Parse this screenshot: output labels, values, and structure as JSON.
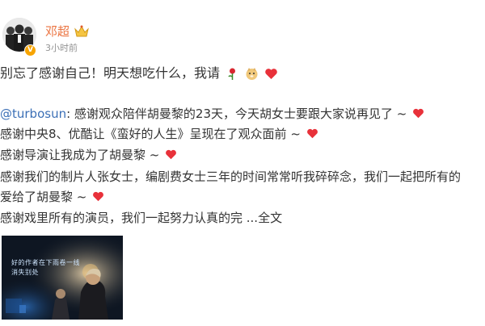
{
  "post": {
    "author": {
      "name": "邓超",
      "time": "3小时前",
      "avatar_icon": "avatar-group-photo",
      "verified_icon": "verified-badge-icon",
      "crown_badge_icon": "fan-crown-badge-icon"
    },
    "headline": "别忘了感谢自己！明天想吃什么，我请",
    "headline_emojis": [
      "rose-icon",
      "doge-icon",
      "heart-icon"
    ],
    "lines": [
      {
        "mention": "@turbosun",
        "text": ": 感谢观众陪伴胡曼黎的23天，今天胡女士要跟大家说再见了 ~",
        "emoji": "heart-icon"
      },
      {
        "text": "感谢中央8、优酷让《蛮好的人生》呈现在了观众面前 ~",
        "emoji": "heart-icon"
      },
      {
        "text": "感谢导演让我成为了胡曼黎 ~",
        "emoji": "heart-icon"
      },
      {
        "text": "感谢我们的制片人张女士，编剧费女士三年的时间常常听我碎碎念，我们一起把所有的"
      },
      {
        "text": "爱给了胡曼黎 ~",
        "emoji": "heart-icon"
      },
      {
        "text": "感谢戏里所有的演员，我们一起努力认真的完 ...全文"
      }
    ],
    "media": {
      "caption_line1": "好的作者在下雨卷一线",
      "caption_line2": "消失别处"
    },
    "colors": {
      "name": "#eb7340",
      "mention": "#3b6fb6",
      "heart": "#e8313a",
      "text": "#333333",
      "time": "#939393"
    }
  }
}
